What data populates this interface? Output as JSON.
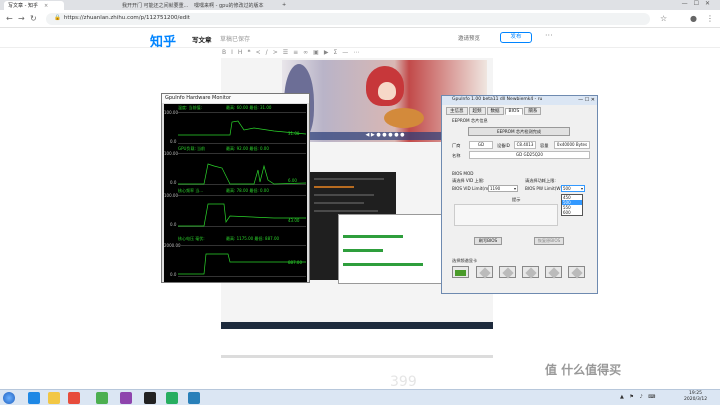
{
  "browser": {
    "tabs": [
      {
        "label": "写文章 - 知乎",
        "active": true
      },
      {
        "label": "我开开门 可能还之间就要重...",
        "active": false
      },
      {
        "label": "嘿嘿来啊 - gpu的修改过的版本",
        "active": false
      }
    ],
    "url": "https://zhuanlan.zhihu.com/p/112751200/edit"
  },
  "zhihu": {
    "logo": "知乎",
    "write": "写文章",
    "draft_status": "草稿已保存",
    "preview": "邀请预览",
    "publish": "发布",
    "more": "···"
  },
  "gpu_monitor": {
    "title": "GpuInfo Hardware Monitor",
    "graphs": [
      {
        "label": "温度: 当前值:",
        "readout": "最高: 60.00  最低: 31.00",
        "ymax": "100.00",
        "ymin": "0.0",
        "value": "31.00"
      },
      {
        "label": "GPU负载: 当前",
        "readout": "最高: 92.00  最低: 0.00",
        "ymax": "100.00",
        "ymin": "0.0",
        "value": "6.00"
      },
      {
        "label": "核心频率 当...",
        "readout": "最高: 78.00  最低: 0.00",
        "ymax": "100.00",
        "ymin": "0.0",
        "value": "43.00"
      },
      {
        "label": "核心电压 毫伏:",
        "readout": "最高: 1175.00  最低: 887.00",
        "ymax": "2000.00",
        "ymin": "0.0",
        "value": "887.00"
      }
    ]
  },
  "bios_tool": {
    "title": "GpuInfo 1.00 beta11 dll Newbiemk4 - ru",
    "tabs": [
      "主信息",
      "超频",
      "数据",
      "BIOS",
      "關系"
    ],
    "section_eeprom": "EEPROM 芯片信息",
    "btn_eeprom": "EEPROM 芯片检测完成",
    "vendor_label": "厂商",
    "vendor": "GD",
    "device_id_label": "设备ID",
    "device_id": "C8.4013",
    "capacity_label": "容量",
    "capacity": "0x40000 Bytes",
    "name_label": "名称",
    "name": "GD GD25Q20",
    "section_mod": "BIOS MOD",
    "vid_label": "请选择 VID 上限:",
    "vid_field_label": "BIOS VID Limit(mV)",
    "vid_value": "1190",
    "pw_label": "请选择功耗上限:",
    "pw_field_label": "BIOS PW Limit(W)",
    "pw_value": "500",
    "pw_options": [
      "450",
      "500",
      "550",
      "600"
    ],
    "hint": "提示",
    "btn_refresh": "刷写BIOS",
    "btn_restore": "恢复原BIOS",
    "mode_label": "选择频谱显卡"
  },
  "desktop": {
    "watermark": "值 什么值得买",
    "faint_number": "399"
  },
  "taskbar": {
    "time": "19:25",
    "date": "2020/3/12"
  }
}
